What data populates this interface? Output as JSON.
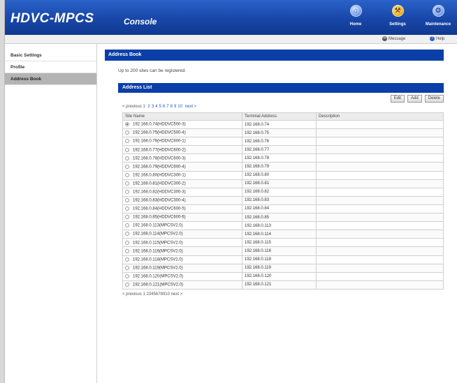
{
  "header": {
    "brand": "HDVC-MPCS",
    "console": "Console",
    "buttons": [
      {
        "label": "Home",
        "icon": "home-icon"
      },
      {
        "label": "Settings",
        "icon": "wrench-icon"
      },
      {
        "label": "Maintenance",
        "icon": "maintenance-icon"
      }
    ]
  },
  "subbar": {
    "message": "Message",
    "help": "Help"
  },
  "sidebar": {
    "items": [
      {
        "label": "Basic Settings",
        "active": false
      },
      {
        "label": "Profile",
        "active": false
      },
      {
        "label": "Address Book",
        "active": true
      }
    ]
  },
  "main": {
    "title": "Address Book",
    "note": "Up to 200 sites can be registered.",
    "list_title": "Address List",
    "toolbar": {
      "edit": "Edit",
      "add": "Add",
      "delete": "Delete"
    },
    "pager": {
      "previous": "< previous",
      "current": "1",
      "pages": [
        "2",
        "3",
        "4",
        "5",
        "6",
        "7",
        "8",
        "9",
        "10"
      ],
      "next": "next >"
    },
    "columns": [
      "Site Name",
      "Terminal Address",
      "Description"
    ],
    "rows": [
      {
        "site": "192.168.0.74(HDDVC500-3)",
        "address": "192.168.0.74",
        "desc": "",
        "selected": true
      },
      {
        "site": "192.168.0.75(HDDVC500-4)",
        "address": "192.168.0.75",
        "desc": "",
        "selected": false
      },
      {
        "site": "192.168.0.76(HDDVC600-1)",
        "address": "192.168.0.76",
        "desc": "",
        "selected": false
      },
      {
        "site": "192.168.0.77(HDDVC600-2)",
        "address": "192.168.0.77",
        "desc": "",
        "selected": false
      },
      {
        "site": "192.168.0.78(HDDVC600-3)",
        "address": "192.168.0.78",
        "desc": "",
        "selected": false
      },
      {
        "site": "192.168.0.79(HDDVC600-4)",
        "address": "192.168.0.79",
        "desc": "",
        "selected": false
      },
      {
        "site": "192.168.0.80(HDDVC300-1)",
        "address": "192.168.0.80",
        "desc": "",
        "selected": false
      },
      {
        "site": "192.168.0.81(HDDVC300-2)",
        "address": "192.168.0.81",
        "desc": "",
        "selected": false
      },
      {
        "site": "192.168.0.82(HDDVC300-3)",
        "address": "192.168.0.82",
        "desc": "",
        "selected": false
      },
      {
        "site": "192.168.0.83(HDDVC300-4)",
        "address": "192.168.0.83",
        "desc": "",
        "selected": false
      },
      {
        "site": "192.168.0.84(HDDVC600-5)",
        "address": "192.168.0.84",
        "desc": "",
        "selected": false
      },
      {
        "site": "192.168.0.85(HDDVC600-6)",
        "address": "192.168.0.85",
        "desc": "",
        "selected": false
      },
      {
        "site": "192.168.0.113(MPCSV2.0)",
        "address": "192.168.0.113",
        "desc": "",
        "selected": false
      },
      {
        "site": "192.168.0.114(MPCSV2.0)",
        "address": "192.168.0.114",
        "desc": "",
        "selected": false
      },
      {
        "site": "192.168.0.115(MPCSV2.0)",
        "address": "192.168.0.115",
        "desc": "",
        "selected": false
      },
      {
        "site": "192.168.0.116(MPCSV2.0)",
        "address": "192.168.0.116",
        "desc": "",
        "selected": false
      },
      {
        "site": "192.168.0.118(MPCSV2.0)",
        "address": "192.168.0.118",
        "desc": "",
        "selected": false
      },
      {
        "site": "192.168.0.119(MPCSV2.0)",
        "address": "192.168.0.119",
        "desc": "",
        "selected": false
      },
      {
        "site": "192.168.0.120(MPCSV2.0)",
        "address": "192.168.0.120",
        "desc": "",
        "selected": false
      },
      {
        "site": "192.168.0.121(MPCSV2.0)",
        "address": "192.168.0.121",
        "desc": "",
        "selected": false
      }
    ]
  }
}
